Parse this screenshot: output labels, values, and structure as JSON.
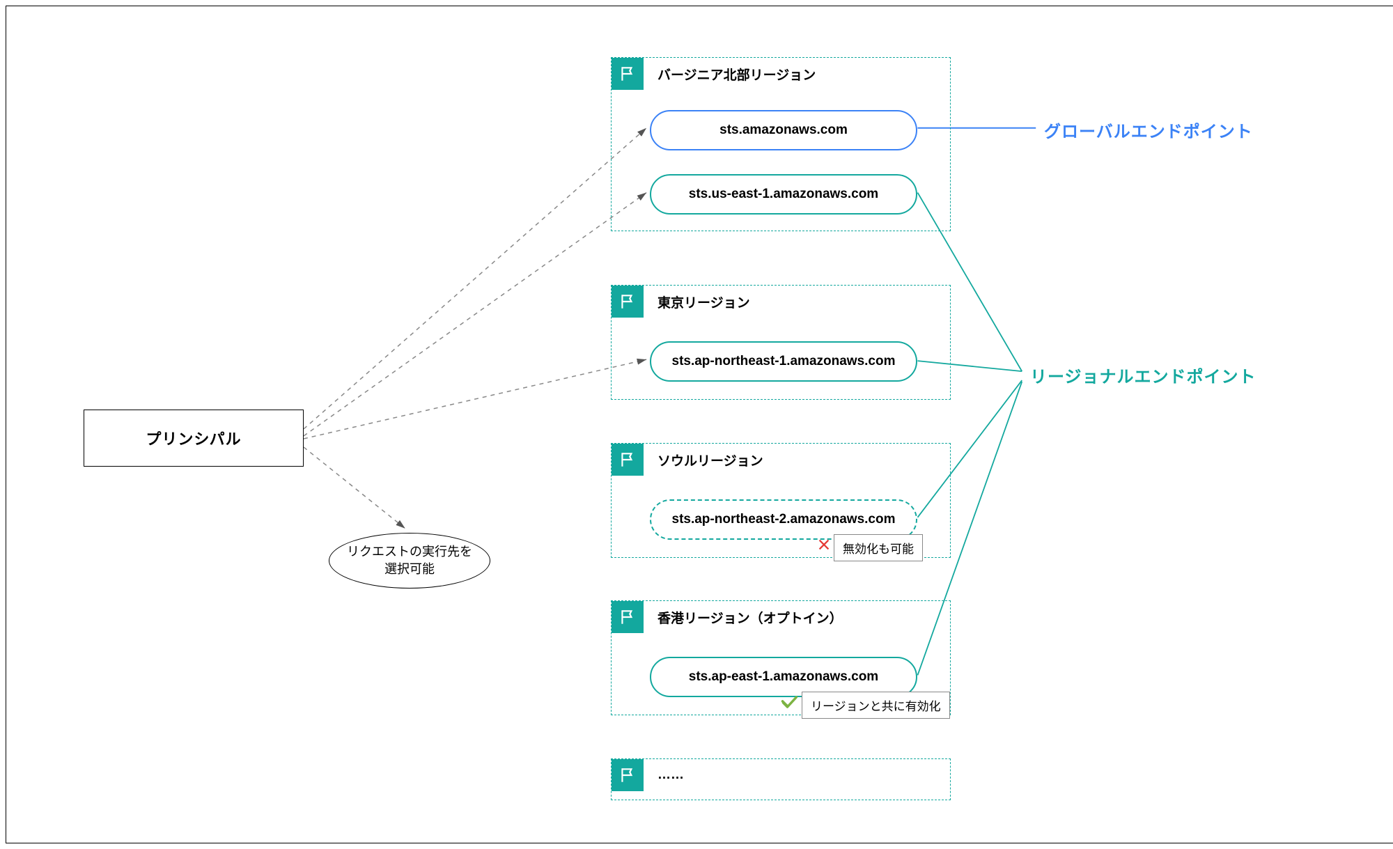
{
  "principal": "プリンシパル",
  "note": "リクエストの実行先を選択可能",
  "regions": {
    "virginia": {
      "title": "バージニア北部リージョン",
      "endpoints": {
        "global": "sts.amazonaws.com",
        "regional": "sts.us-east-1.amazonaws.com"
      }
    },
    "tokyo": {
      "title": "東京リージョン",
      "endpoint": "sts.ap-northeast-1.amazonaws.com"
    },
    "seoul": {
      "title": "ソウルリージョン",
      "endpoint": "sts.ap-northeast-2.amazonaws.com",
      "tag": "無効化も可能"
    },
    "hongkong": {
      "title": "香港リージョン（オプトイン）",
      "endpoint": "sts.ap-east-1.amazonaws.com",
      "tag": "リージョンと共に有効化"
    },
    "more": "……"
  },
  "labels": {
    "global_endpoint": "グローバルエンドポイント",
    "regional_endpoint": "リージョナルエンドポイント"
  },
  "chart_data": {
    "type": "diagram",
    "nodes": [
      {
        "id": "principal",
        "label": "プリンシパル"
      },
      {
        "id": "note",
        "label": "リクエストの実行先を選択可能",
        "shape": "ellipse"
      },
      {
        "id": "virginia",
        "label": "バージニア北部リージョン",
        "endpoints": [
          "sts.amazonaws.com",
          "sts.us-east-1.amazonaws.com"
        ]
      },
      {
        "id": "tokyo",
        "label": "東京リージョン",
        "endpoints": [
          "sts.ap-northeast-1.amazonaws.com"
        ]
      },
      {
        "id": "seoul",
        "label": "ソウルリージョン",
        "endpoints": [
          "sts.ap-northeast-2.amazonaws.com"
        ],
        "tag": "無効化も可能",
        "state": "dashed"
      },
      {
        "id": "hongkong",
        "label": "香港リージョン（オプトイン）",
        "endpoints": [
          "sts.ap-east-1.amazonaws.com"
        ],
        "tag": "リージョンと共に有効化"
      },
      {
        "id": "more",
        "label": "……"
      },
      {
        "id": "global_label",
        "label": "グローバルエンドポイント",
        "color": "#3B82F6"
      },
      {
        "id": "regional_label",
        "label": "リージョナルエンドポイント",
        "color": "#13A89E"
      }
    ],
    "edges": [
      {
        "from": "principal",
        "to": "virginia.global",
        "style": "dashed-arrow"
      },
      {
        "from": "principal",
        "to": "virginia.regional",
        "style": "dashed-arrow"
      },
      {
        "from": "principal",
        "to": "tokyo.endpoint",
        "style": "dashed-arrow"
      },
      {
        "from": "principal",
        "to": "note",
        "style": "dashed-arrow"
      },
      {
        "from": "virginia.global",
        "to": "global_label",
        "style": "solid-blue"
      },
      {
        "from": "virginia.regional",
        "to": "regional_label",
        "style": "solid-teal"
      },
      {
        "from": "tokyo.endpoint",
        "to": "regional_label",
        "style": "solid-teal"
      },
      {
        "from": "seoul.endpoint",
        "to": "regional_label",
        "style": "solid-teal"
      },
      {
        "from": "hongkong.endpoint",
        "to": "regional_label",
        "style": "solid-teal"
      }
    ]
  }
}
